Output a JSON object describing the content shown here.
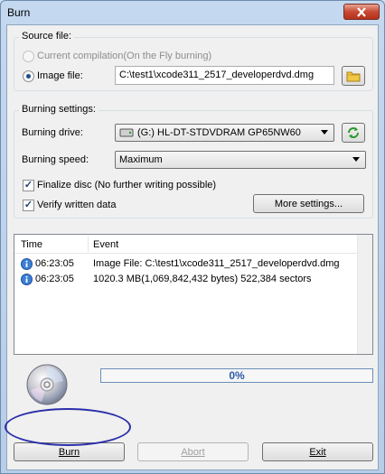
{
  "window": {
    "title": "Burn"
  },
  "source": {
    "group_title": "Source file:",
    "current_compilation_label": "Current compilation(On the Fly burning)",
    "image_file_label": "Image file:",
    "image_file_value": "C:\\test1\\xcode311_2517_developerdvd.dmg",
    "selected": "image_file"
  },
  "settings": {
    "group_title": "Burning settings:",
    "drive_label": "Burning drive:",
    "drive_value": "(G:) HL-DT-STDVDRAM GP65NW60",
    "speed_label": "Burning speed:",
    "speed_value": "Maximum",
    "finalize_label": "Finalize disc (No further writing possible)",
    "finalize_checked": true,
    "verify_label": "Verify written data",
    "verify_checked": true,
    "more_settings_label": "More settings..."
  },
  "log": {
    "columns": [
      "Time",
      "Event"
    ],
    "rows": [
      {
        "time": "06:23:05",
        "event": "Image File:  C:\\test1\\xcode311_2517_developerdvd.dmg"
      },
      {
        "time": "06:23:05",
        "event": "1020.3 MB(1,069,842,432 bytes)  522,384 sectors"
      }
    ]
  },
  "progress": {
    "text": "0%",
    "fraction": 0
  },
  "buttons": {
    "burn": "Burn",
    "abort": "Abort",
    "exit": "Exit"
  },
  "icons": {
    "close": "close-icon",
    "folder": "folder-icon",
    "drive": "drive-icon",
    "refresh": "refresh-icon",
    "info": "info-icon",
    "disc": "disc-icon"
  }
}
